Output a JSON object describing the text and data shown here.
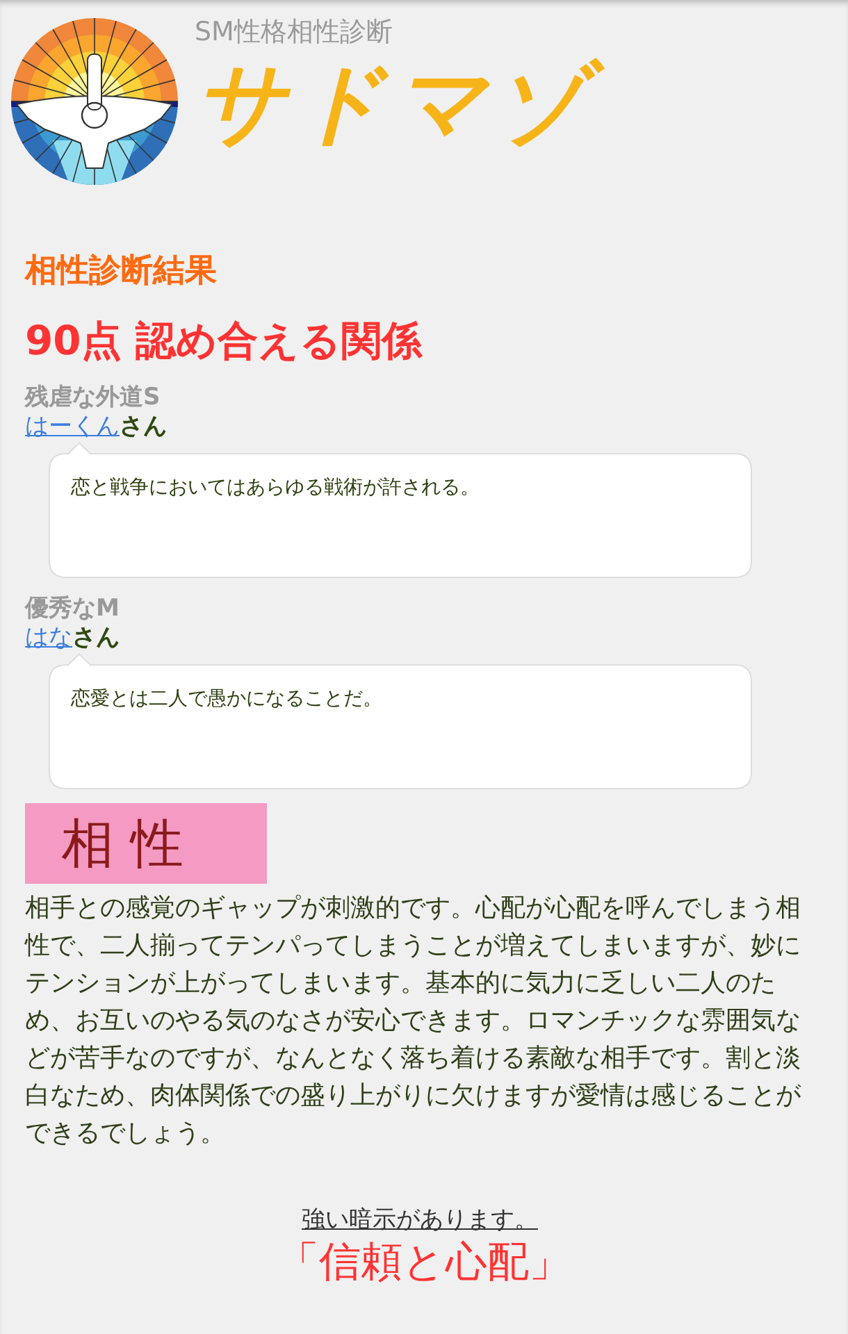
{
  "header": {
    "subtitle": "SM性格相性診断",
    "logo_text": "サドマゾ"
  },
  "result": {
    "heading": "相性診断結果",
    "score": "90点 認め合える関係"
  },
  "people": [
    {
      "type_label": "残虐な外道S",
      "name": "はーくん",
      "honorific": "さん",
      "quote": "恋と戦争においてはあらゆる戦術が許される。"
    },
    {
      "type_label": "優秀なM",
      "name": "はな",
      "honorific": "さん",
      "quote": "恋愛とは二人で愚かになることだ。"
    }
  ],
  "compatibility": {
    "label": "相 性",
    "description": "相手との感覚のギャップが刺激的です。心配が心配を呼んでしまう相性で、二人揃ってテンパってしまうことが増えてしまいますが、妙にテンションが上がってしまいます。基本的に気力に乏しい二人のため、お互いのやる気のなさが安心できます。ロマンチックな雰囲気などが苦手なのですが、なんとなく落ち着ける素敵な相手です。割と淡白なため、肉体関係での盛り上がりに欠けますが愛情は感じることができるでしょう。"
  },
  "hint": {
    "notice": "強い暗示があります。",
    "keyword": "「信頼と心配」"
  }
}
